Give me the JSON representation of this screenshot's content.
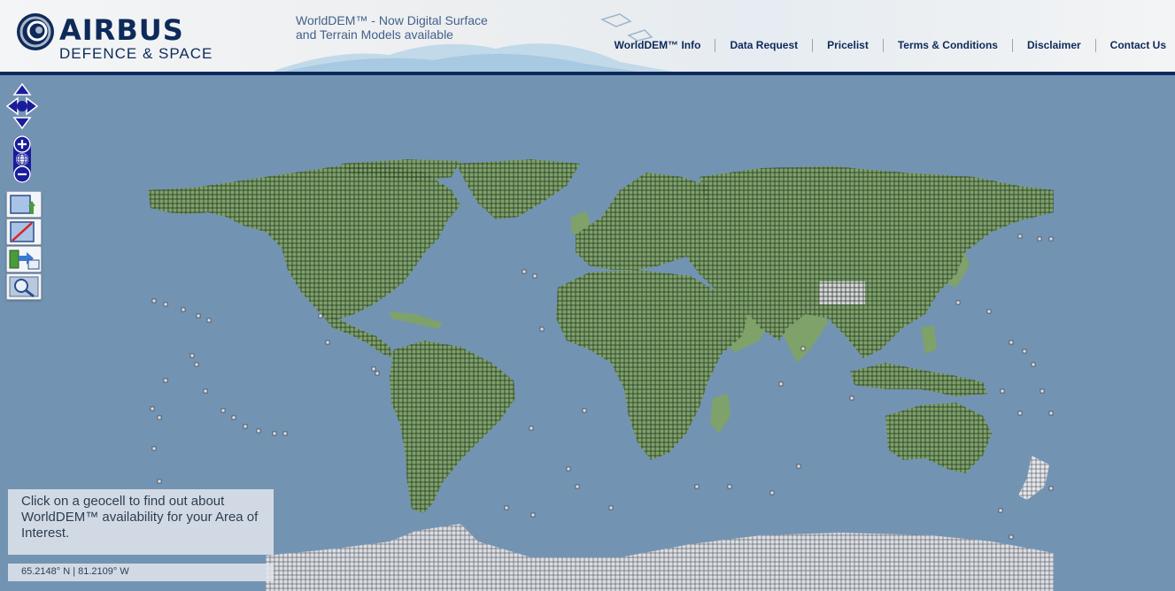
{
  "brand": {
    "name": "AIRBUS",
    "division": "DEFENCE & SPACE"
  },
  "promo": {
    "line1": "WorldDEM™ - Now Digital Surface",
    "line2": "and Terrain Models available"
  },
  "nav": {
    "items": [
      {
        "label": "WorldDEM™ Info"
      },
      {
        "label": "Data Request"
      },
      {
        "label": "Pricelist"
      },
      {
        "label": "Terms & Conditions"
      },
      {
        "label": "Disclaimer"
      },
      {
        "label": "Contact Us"
      }
    ]
  },
  "map": {
    "info_message": "Click on a geocell to find out about WorldDEM™ availability for your Area of Interest.",
    "coordinate_readout": "65.2148° N | 81.2109° W"
  },
  "tools": [
    {
      "icon": "area-select-icon"
    },
    {
      "icon": "clear-selection-icon"
    },
    {
      "icon": "export-icon"
    },
    {
      "icon": "zoom-extent-icon"
    }
  ],
  "colors": {
    "ocean": "#7393b3",
    "land": "#7ea26a",
    "brand": "#0e2a5a",
    "antarctica": "#dcdee3"
  }
}
